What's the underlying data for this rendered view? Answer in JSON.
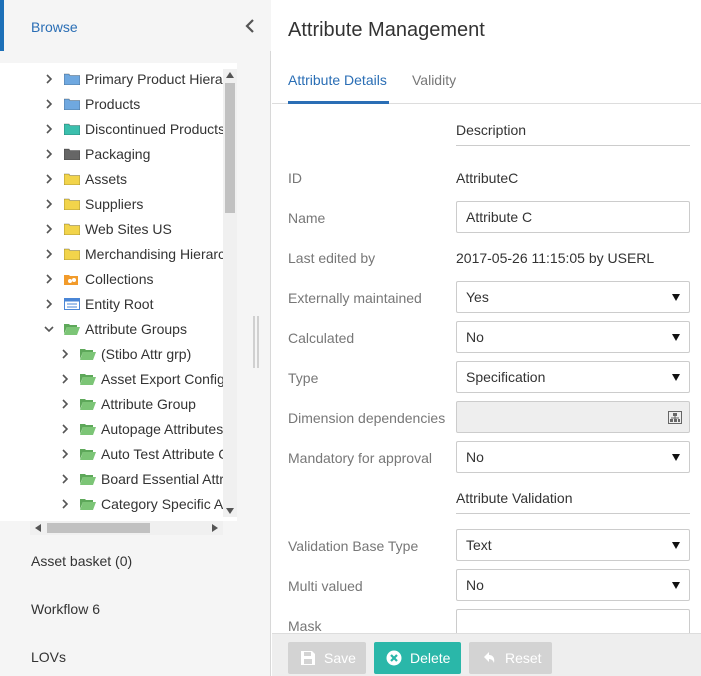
{
  "sidebar": {
    "title": "Browse",
    "tree": [
      {
        "label": "Primary Product Hiera",
        "icon": "folder-blue-icon",
        "expanded": false,
        "level": 0,
        "color": "#6fa8e0"
      },
      {
        "label": "Products",
        "icon": "folder-blue-icon",
        "expanded": false,
        "level": 0,
        "color": "#6fa8e0"
      },
      {
        "label": "Discontinued Products",
        "icon": "folder-teal-icon",
        "expanded": false,
        "level": 0,
        "color": "#3bbfad"
      },
      {
        "label": "Packaging",
        "icon": "folder-gray-icon",
        "expanded": false,
        "level": 0,
        "color": "#666666"
      },
      {
        "label": "Assets",
        "icon": "folder-yellow-icon",
        "expanded": false,
        "level": 0,
        "color": "#f2d44b"
      },
      {
        "label": "Suppliers",
        "icon": "folder-yellow-icon",
        "expanded": false,
        "level": 0,
        "color": "#f2d44b"
      },
      {
        "label": "Web Sites US",
        "icon": "folder-yellow-icon",
        "expanded": false,
        "level": 0,
        "color": "#f2d44b"
      },
      {
        "label": "Merchandising Hierarc",
        "icon": "folder-yellow-icon",
        "expanded": false,
        "level": 0,
        "color": "#f2d44b"
      },
      {
        "label": "Collections",
        "icon": "collections-icon",
        "expanded": false,
        "level": 0,
        "color": "#f29b2b"
      },
      {
        "label": "Entity Root",
        "icon": "entity-icon",
        "expanded": false,
        "level": 0,
        "color": "#4a86d6"
      },
      {
        "label": "Attribute Groups",
        "icon": "folder-open-green-icon",
        "expanded": true,
        "level": 0,
        "color": "#7cc576"
      },
      {
        "label": "(Stibo Attr grp)",
        "icon": "folder-open-green-icon",
        "expanded": false,
        "level": 1,
        "color": "#7cc576"
      },
      {
        "label": "Asset Export Config",
        "icon": "folder-open-green-icon",
        "expanded": false,
        "level": 1,
        "color": "#7cc576"
      },
      {
        "label": "Attribute Group",
        "icon": "folder-open-green-icon",
        "expanded": false,
        "level": 1,
        "color": "#7cc576"
      },
      {
        "label": "Autopage Attributes",
        "icon": "folder-open-green-icon",
        "expanded": false,
        "level": 1,
        "color": "#7cc576"
      },
      {
        "label": "Auto Test Attribute G",
        "icon": "folder-open-green-icon",
        "expanded": false,
        "level": 1,
        "color": "#7cc576"
      },
      {
        "label": "Board Essential Attri",
        "icon": "folder-open-green-icon",
        "expanded": false,
        "level": 1,
        "color": "#7cc576"
      },
      {
        "label": "Category Specific A",
        "icon": "folder-open-green-icon",
        "expanded": false,
        "level": 1,
        "color": "#7cc576"
      }
    ],
    "nav": [
      {
        "label": "Asset basket (0)"
      },
      {
        "label": "Workflow 6"
      },
      {
        "label": "LOVs"
      }
    ]
  },
  "main": {
    "title": "Attribute Management",
    "tabs": [
      {
        "label": "Attribute Details",
        "active": true
      },
      {
        "label": "Validity",
        "active": false
      }
    ],
    "section_description": "Description",
    "section_validation": "Attribute Validation",
    "fields": {
      "id": {
        "label": "ID",
        "value": "AttributeC"
      },
      "name": {
        "label": "Name",
        "value": "Attribute C"
      },
      "last_edited": {
        "label": "Last edited by",
        "value": "2017-05-26 11:15:05 by USERL"
      },
      "externally_maintained": {
        "label": "Externally maintained",
        "value": "Yes"
      },
      "calculated": {
        "label": "Calculated",
        "value": "No"
      },
      "type": {
        "label": "Type",
        "value": "Specification"
      },
      "dimension_dependencies": {
        "label": "Dimension dependencies",
        "value": ""
      },
      "mandatory": {
        "label": "Mandatory for approval",
        "value": "No"
      },
      "validation_base_type": {
        "label": "Validation Base Type",
        "value": "Text"
      },
      "multi_valued": {
        "label": "Multi valued",
        "value": "No"
      },
      "mask": {
        "label": "Mask",
        "value": ""
      }
    },
    "buttons": {
      "save": "Save",
      "delete": "Delete",
      "reset": "Reset"
    }
  },
  "colors": {
    "accent": "#2a6eb5",
    "delete": "#2ab7a9",
    "disabled_button": "#d3d3d3"
  }
}
